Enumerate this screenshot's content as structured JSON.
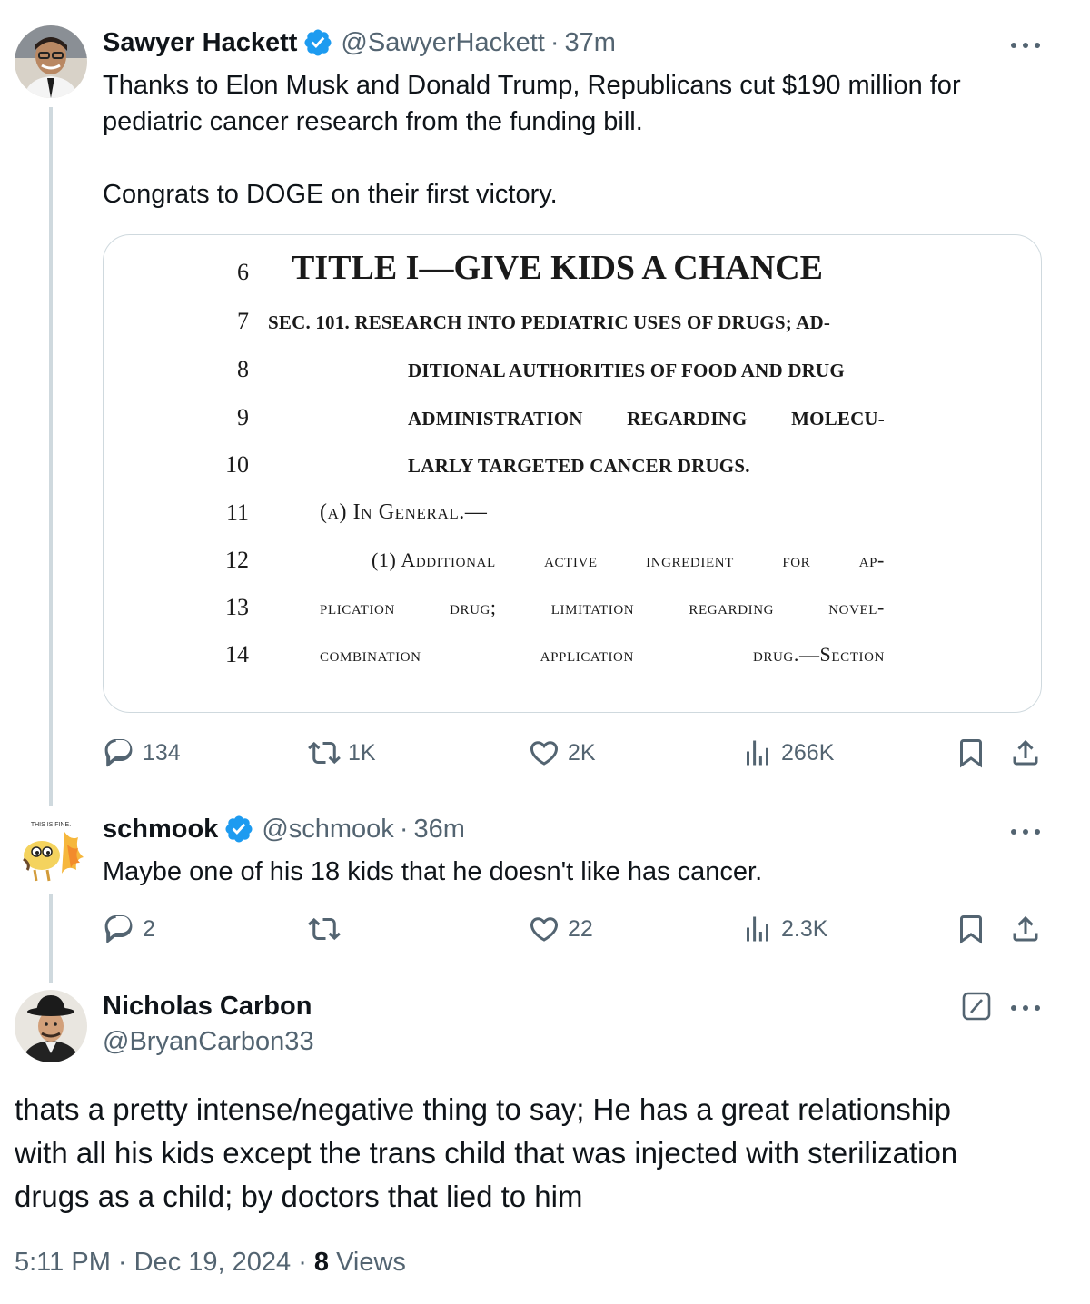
{
  "tweets": [
    {
      "name": "Sawyer Hackett",
      "handle": "@SawyerHackett",
      "time": "37m",
      "text": "Thanks to Elon Musk and Donald Trump, Republicans cut $190 million for\npediatric cancer research from the funding bill.\n\nCongrats to DOGE on their first victory.",
      "replies": "134",
      "reposts": "1K",
      "likes": "2K",
      "views": "266K"
    },
    {
      "name": "schmook",
      "handle": "@schmook",
      "time": "36m",
      "text": "Maybe one of his 18 kids that he doesn't like has cancer.",
      "replies": "2",
      "reposts": "",
      "likes": "22",
      "views": "2.3K",
      "avatar_caption": "THIS IS FINE."
    }
  ],
  "main_tweet": {
    "name": "Nicholas Carbon",
    "handle": "@BryanCarbon33",
    "text": "thats a pretty intense/negative thing to say; He has a great relationship\nwith all his kids except the trans child that was injected with sterilization\ndrugs as a child; by doctors that lied to him",
    "timestamp": "5:11 PM · Dec 19, 2024 · ",
    "views_count": "8",
    "views_label": " Views"
  },
  "document": {
    "line_numbers": [
      "6",
      "7",
      "8",
      "9",
      "10",
      "11",
      "12",
      "13",
      "14"
    ],
    "title": "TITLE I—GIVE KIDS A CHANCE",
    "sec_line": "SEC. 101. RESEARCH INTO PEDIATRIC USES OF DRUGS; AD-",
    "line8": "DITIONAL AUTHORITIES OF FOOD AND DRUG",
    "line9": [
      "ADMINISTRATION",
      "REGARDING",
      "MOLECU-"
    ],
    "line10": "LARLY TARGETED CANCER DRUGS.",
    "line11": "(a) In General.—",
    "line12": [
      "(1) Additional",
      "active",
      "ingredient",
      "for",
      "ap-"
    ],
    "line13": [
      "plication",
      "drug;",
      "limitation",
      "regarding",
      "novel-"
    ],
    "line14": [
      "combination",
      "application",
      "drug.—Section"
    ]
  },
  "colors": {
    "text": "#0f1419",
    "secondary": "#536471",
    "verified": "#1d9bf0",
    "border": "#cfd9de"
  },
  "icons": [
    "reply-icon",
    "repost-icon",
    "like-icon",
    "views-icon",
    "bookmark-icon",
    "share-icon",
    "more-icon",
    "verified-badge-icon",
    "grok-icon"
  ]
}
